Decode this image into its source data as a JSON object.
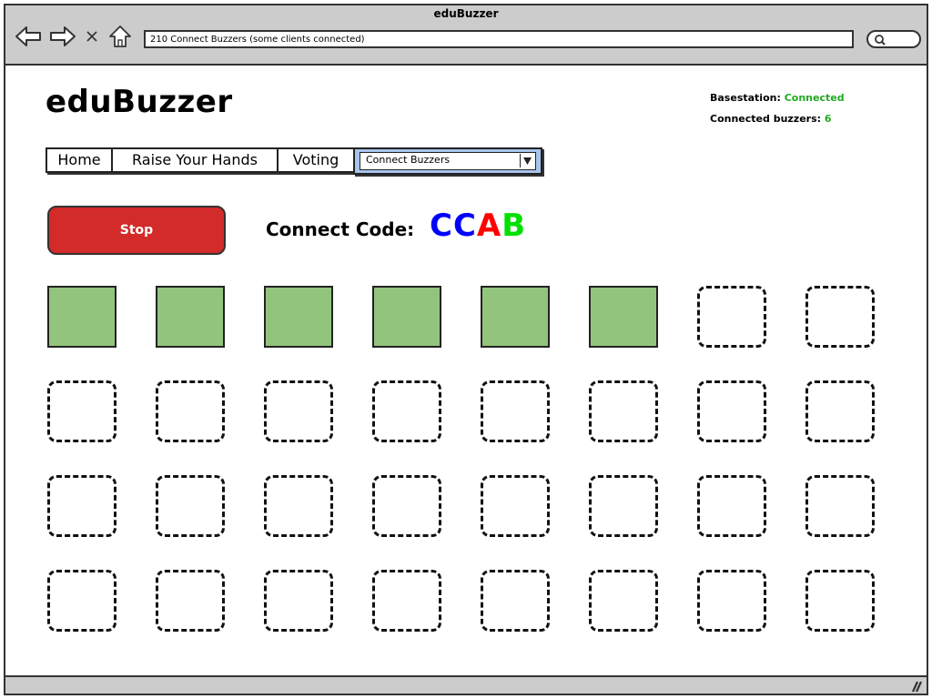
{
  "window": {
    "title": "eduBuzzer",
    "url": "210 Connect Buzzers (some clients connected)",
    "icons": [
      "back-arrow-icon",
      "forward-arrow-icon",
      "close-x-icon",
      "home-icon",
      "search-icon"
    ]
  },
  "header": {
    "app_title": "eduBuzzer",
    "basestation_label": "Basestation:",
    "basestation_value": "Connected",
    "buzzers_label": "Connected buzzers:",
    "buzzers_value": "6",
    "status_color": "#22a822"
  },
  "nav": {
    "tabs": [
      {
        "label": "Home"
      },
      {
        "label": "Raise Your Hands"
      },
      {
        "label": "Voting"
      }
    ],
    "dropdown": {
      "selected": "Connect Buzzers",
      "highlight_color": "#a8c4ec"
    }
  },
  "controls": {
    "stop_label": "Stop",
    "stop_color": "#d32a2a",
    "connect_code_label": "Connect Code:",
    "connect_code": [
      {
        "char": "C",
        "color": "#0000ff"
      },
      {
        "char": "C",
        "color": "#0000ff"
      },
      {
        "char": "A",
        "color": "#ff0000"
      },
      {
        "char": "B",
        "color": "#00e000"
      }
    ]
  },
  "buzzer_grid": {
    "columns": 8,
    "rows": 4,
    "total_slots": 32,
    "connected_count": 6,
    "connected_color": "#93c47d",
    "slots": [
      true,
      true,
      true,
      true,
      true,
      true,
      false,
      false,
      false,
      false,
      false,
      false,
      false,
      false,
      false,
      false,
      false,
      false,
      false,
      false,
      false,
      false,
      false,
      false,
      false,
      false,
      false,
      false,
      false,
      false,
      false,
      false
    ]
  }
}
